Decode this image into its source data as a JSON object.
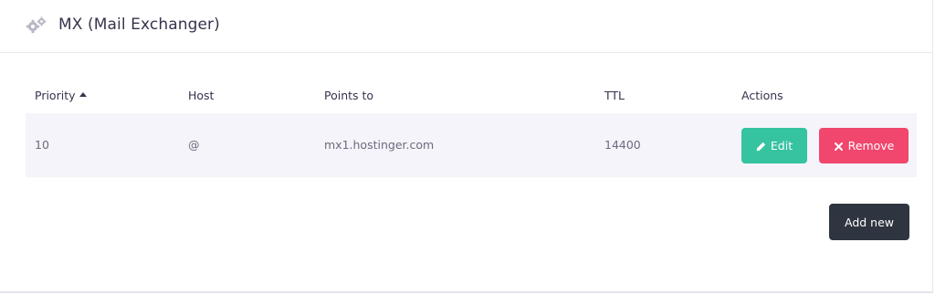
{
  "section": {
    "title": "MX (Mail Exchanger)",
    "icon": "gears-icon"
  },
  "table": {
    "columns": [
      "Priority",
      "Host",
      "Points to",
      "TTL",
      "Actions"
    ],
    "sorted_column": "Priority",
    "sort_direction": "ascending",
    "rows": [
      {
        "priority": "10",
        "host": "@",
        "points_to": "mx1.hostinger.com",
        "ttl": "14400"
      }
    ],
    "actions": {
      "edit_label": "Edit",
      "remove_label": "Remove"
    }
  },
  "footer": {
    "add_new_label": "Add new"
  },
  "colors": {
    "edit": "#35c3a0",
    "remove": "#f1466d",
    "add_new": "#2f3540",
    "row_background": "#f4f4fa"
  }
}
